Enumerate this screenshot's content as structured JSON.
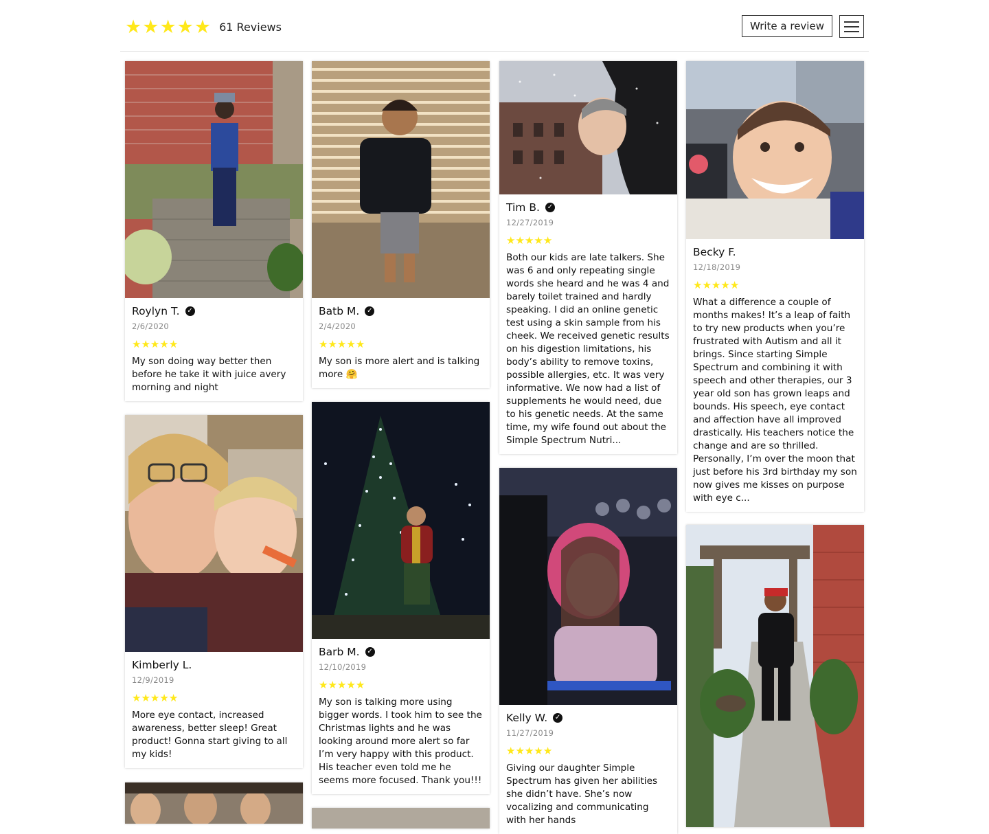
{
  "header": {
    "stars": [
      "★",
      "★",
      "★",
      "★",
      "★"
    ],
    "review_count": "61 Reviews",
    "write_review_label": "Write a review",
    "menu_icon": "hamburger-menu-icon"
  },
  "colors": {
    "star": "#ffe81a",
    "verified": "#111111",
    "border": "#dcdcdc"
  },
  "reviews": [
    {
      "name": "Roylyn T.",
      "verified": true,
      "date": "2/6/2020",
      "rating": 5,
      "text": "My son doing way better then before  he take it with juice avery morning and night"
    },
    {
      "name": "Kimberly L.",
      "verified": false,
      "date": "12/9/2019",
      "rating": 5,
      "text": "More eye contact, increased awareness, better sleep! Great product! Gonna start giving to all my kids!"
    },
    {
      "name": "Batb M.",
      "verified": true,
      "date": "2/4/2020",
      "rating": 5,
      "text": "My son is more alert and is talking more 🤗"
    },
    {
      "name": "Barb M.",
      "verified": true,
      "date": "12/10/2019",
      "rating": 5,
      "text": "My son is talking more using bigger words. I took him to see the Christmas lights and he was looking around more alert so far I’m very happy with this product. His teacher even told me he seems more focused. Thank you!!!"
    },
    {
      "name": "Tim B.",
      "verified": true,
      "date": "12/27/2019",
      "rating": 5,
      "text": "Both our kids are late talkers. She was 6 and only repeating single words she heard and he was 4 and barely toilet trained and hardly speaking.  I did an online genetic test using a skin sample from his cheek.  We received genetic results on his digestion limitations, his body’s ability to remove toxins, possible allergies, etc.  It was very informative.  We now had a list of supplements he would need, due to his genetic needs.  At the same time, my wife found out about the Simple Spectrum Nutri..."
    },
    {
      "name": "Kelly W.",
      "verified": true,
      "date": "11/27/2019",
      "rating": 5,
      "text": "Giving our daughter Simple Spectrum has given her abilities she didn’t have.  She’s now vocalizing and communicating with her hands"
    },
    {
      "name": "Becky F.",
      "verified": false,
      "date": "12/18/2019",
      "rating": 5,
      "text": "What a difference a couple of months makes! It’s a leap of faith to try new products when you’re frustrated with Autism and all it brings. Since starting Simple Spectrum and combining it with speech and other therapies, our 3 year old son has grown leaps and bounds. His speech, eye contact and affection have all improved drastically. His teachers notice the change and are so thrilled. Personally, I’m over the moon that just before his 3rd birthday my son now gives me kisses on purpose with eye c..."
    }
  ]
}
